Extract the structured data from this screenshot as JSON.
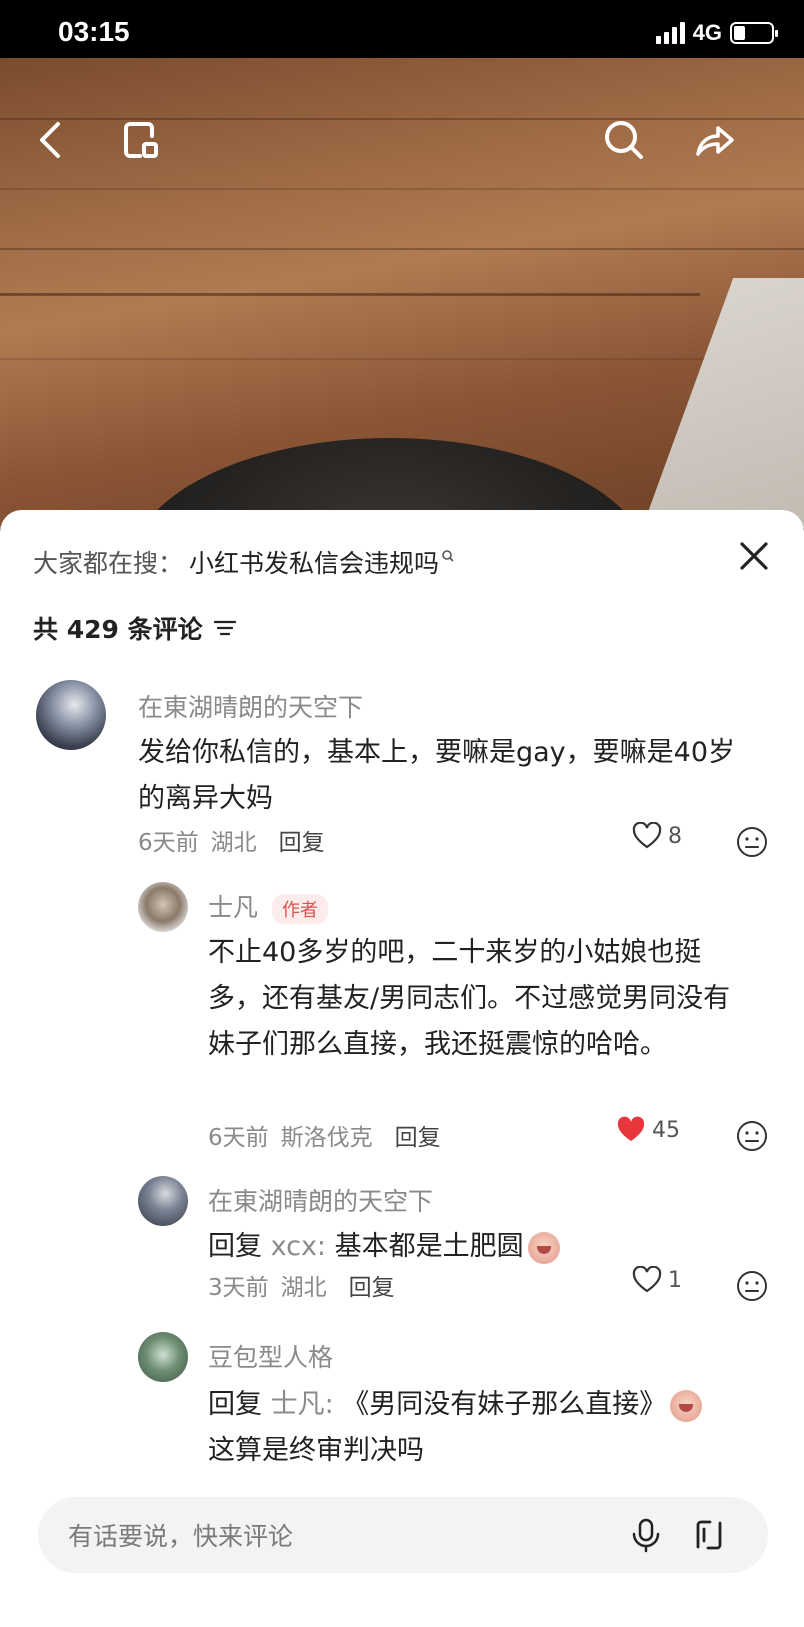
{
  "status_bar": {
    "time": "03:15",
    "network": "4G",
    "battery_level": 0.3
  },
  "nav": {
    "icons": [
      "back-icon",
      "collection-icon",
      "search-icon",
      "share-icon"
    ]
  },
  "sheet": {
    "search_prefix": "大家都在搜：",
    "search_term": "小红书发私信会违规吗",
    "comment_count": "共 429 条评论"
  },
  "comments": [
    {
      "name": "在東湖晴朗的天空下",
      "text": "发给你私信的，基本上，要嘛是gay，要嘛是40岁的离异大妈",
      "time": "6天前",
      "location": "湖北",
      "reply_label": "回复",
      "likes": "8"
    },
    {
      "name": "士凡",
      "tag": "作者",
      "text": "不止40多岁的吧，二十来岁的小姑娘也挺多，还有基友/男同志们。不过感觉男同没有妹子们那么直接，我还挺震惊的哈哈。",
      "time": "6天前",
      "location": "斯洛伐克",
      "reply_label": "回复",
      "likes": "45"
    },
    {
      "name": "在東湖晴朗的天空下",
      "reply_prefix": "回复",
      "reply_target": "xcx:",
      "text": "基本都是土肥圆",
      "time": "3天前",
      "location": "湖北",
      "reply_label": "回复",
      "likes": "1"
    },
    {
      "name": "豆包型人格",
      "reply_prefix": "回复",
      "reply_target": "士凡:",
      "text": "《男同没有妹子那么直接》",
      "text2": "这算是终审判决吗"
    }
  ],
  "input": {
    "placeholder": "有话要说，快来评论"
  },
  "colors": {
    "like_active": "#e8363d",
    "text_muted": "#8a8a8a",
    "author_tag": "#d9534f"
  }
}
